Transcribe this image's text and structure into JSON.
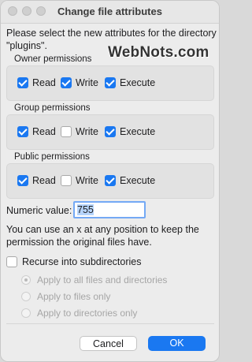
{
  "window": {
    "title": "Change file attributes"
  },
  "intro": "Please select the new attributes for the directory \"plugins\".",
  "watermark": "WebNots.com",
  "sections": [
    {
      "label": "Owner permissions",
      "options": [
        {
          "label": "Read",
          "checked": true
        },
        {
          "label": "Write",
          "checked": true
        },
        {
          "label": "Execute",
          "checked": true
        }
      ]
    },
    {
      "label": "Group permissions",
      "options": [
        {
          "label": "Read",
          "checked": true
        },
        {
          "label": "Write",
          "checked": false
        },
        {
          "label": "Execute",
          "checked": true
        }
      ]
    },
    {
      "label": "Public permissions",
      "options": [
        {
          "label": "Read",
          "checked": true
        },
        {
          "label": "Write",
          "checked": false
        },
        {
          "label": "Execute",
          "checked": true
        }
      ]
    }
  ],
  "numeric": {
    "label": "Numeric value:",
    "value": "755"
  },
  "note": "You can use an x at any position to keep the permission the original files have.",
  "recurse": {
    "label": "Recurse into subdirectories",
    "checked": false
  },
  "apply_options": [
    {
      "label": "Apply to all files and directories",
      "selected": true
    },
    {
      "label": "Apply to files only",
      "selected": false
    },
    {
      "label": "Apply to directories only",
      "selected": false
    }
  ],
  "buttons": {
    "cancel": "Cancel",
    "ok": "OK"
  },
  "colors": {
    "accent": "#1a78f1",
    "background": "#ececec"
  }
}
